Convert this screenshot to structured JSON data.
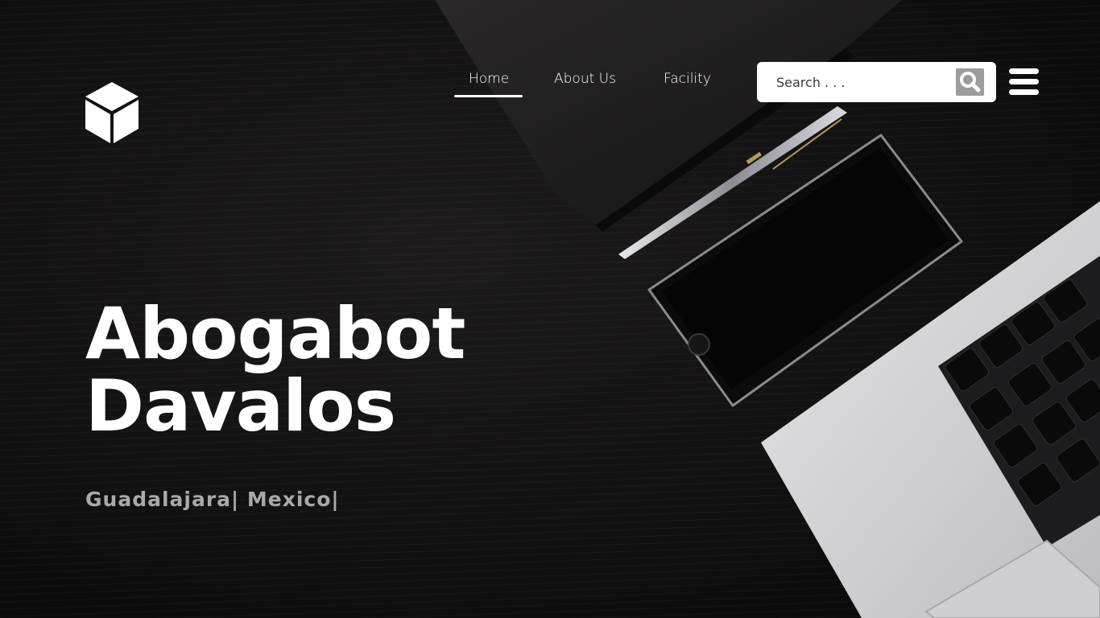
{
  "nav": {
    "items": [
      {
        "label": "Home",
        "active": true
      },
      {
        "label": "About Us",
        "active": false
      },
      {
        "label": "Facility",
        "active": false
      }
    ]
  },
  "search": {
    "placeholder": "Search . . .",
    "value": ""
  },
  "hero": {
    "title_line1": "Abogabot",
    "title_line2": "Davalos",
    "subtitle": "Guadalajara| Mexico|"
  },
  "icons": {
    "logo": "cube-icon",
    "search": "search-icon",
    "menu": "hamburger-menu-icon"
  },
  "colors": {
    "background": "#121111",
    "text": "#ffffff",
    "subtitle": "#a9a9a9",
    "search_button": "#9c9c9c"
  }
}
